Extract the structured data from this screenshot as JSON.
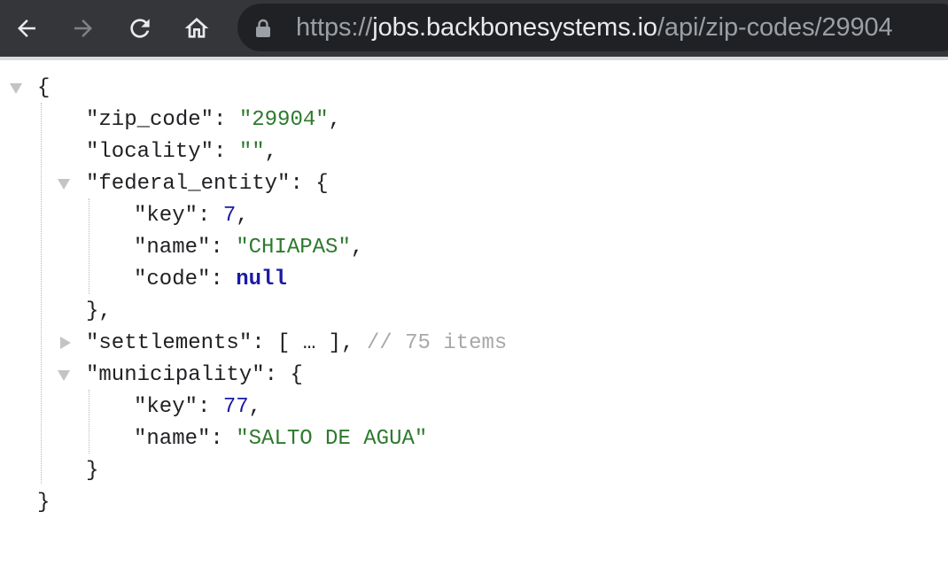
{
  "browser": {
    "url_scheme": "https://",
    "url_host": "jobs.backbonesystems.io",
    "url_path": "/api/zip-codes/29904"
  },
  "json": {
    "open_root": "{",
    "close_root": "}",
    "zip_code_key": "\"zip_code\"",
    "zip_code_value": "\"29904\"",
    "locality_key": "\"locality\"",
    "locality_value": "\"\"",
    "federal_entity_key": "\"federal_entity\"",
    "federal_entity": {
      "key_key": "\"key\"",
      "key_value": "7",
      "name_key": "\"name\"",
      "name_value": "\"CHIAPAS\"",
      "code_key": "\"code\"",
      "code_value": "null"
    },
    "federal_entity_close": "},",
    "settlements_key": "\"settlements\"",
    "settlements_collapsed": "[ … ]",
    "settlements_comment": "// 75 items",
    "municipality_key": "\"municipality\"",
    "municipality": {
      "key_key": "\"key\"",
      "key_value": "77",
      "name_key": "\"name\"",
      "name_value": "\"SALTO DE AGUA\""
    },
    "municipality_close": "}"
  },
  "colors": {
    "toolbar": "#35363a",
    "omnibox": "#202124",
    "string": "#2d7a2d",
    "number": "#1a1aa6",
    "comment": "#a8a8a8"
  },
  "icons": [
    "back-arrow-icon",
    "forward-arrow-icon",
    "reload-icon",
    "home-icon",
    "lock-icon",
    "collapse-triangle-icon",
    "expand-triangle-icon"
  ]
}
